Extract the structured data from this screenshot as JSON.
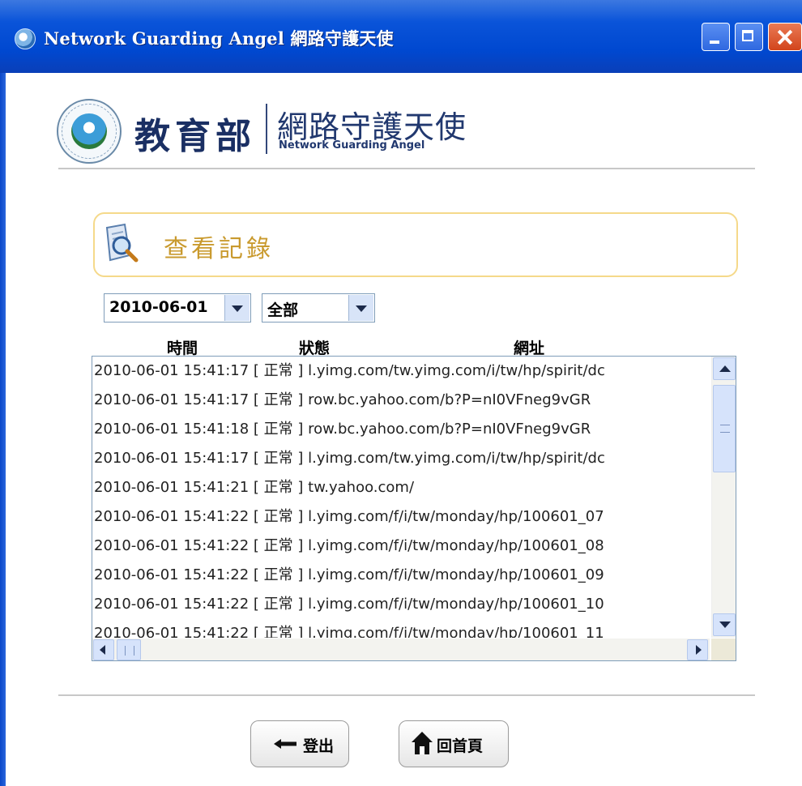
{
  "window": {
    "title": "Network Guarding Angel 網路守護天使"
  },
  "header": {
    "ministry": "教育部",
    "brand_cn": "網路守護天使",
    "brand_en": "Network Guarding Angel"
  },
  "section": {
    "title": "查看記錄"
  },
  "filters": {
    "date": "2010-06-01",
    "status": "全部"
  },
  "columns": [
    "時間",
    "狀態",
    "網址"
  ],
  "rows": [
    {
      "time": "2010-06-01 15:41:17",
      "status": "[ 正常 ]",
      "url": "l.yimg.com/tw.yimg.com/i/tw/hp/spirit/dc"
    },
    {
      "time": "2010-06-01 15:41:17",
      "status": "[ 正常 ]",
      "url": "row.bc.yahoo.com/b?P=nI0VFneg9vGR"
    },
    {
      "time": "2010-06-01 15:41:18",
      "status": "[ 正常 ]",
      "url": "row.bc.yahoo.com/b?P=nI0VFneg9vGR"
    },
    {
      "time": "2010-06-01 15:41:17",
      "status": "[ 正常 ]",
      "url": "l.yimg.com/tw.yimg.com/i/tw/hp/spirit/dc"
    },
    {
      "time": "2010-06-01 15:41:21",
      "status": "[ 正常 ]",
      "url": "tw.yahoo.com/"
    },
    {
      "time": "2010-06-01 15:41:22",
      "status": "[ 正常 ]",
      "url": "l.yimg.com/f/i/tw/monday/hp/100601_07"
    },
    {
      "time": "2010-06-01 15:41:22",
      "status": "[ 正常 ]",
      "url": "l.yimg.com/f/i/tw/monday/hp/100601_08"
    },
    {
      "time": "2010-06-01 15:41:22",
      "status": "[ 正常 ]",
      "url": "l.yimg.com/f/i/tw/monday/hp/100601_09"
    },
    {
      "time": "2010-06-01 15:41:22",
      "status": "[ 正常 ]",
      "url": "l.yimg.com/f/i/tw/monday/hp/100601_10"
    },
    {
      "time": "2010-06-01 15:41:22",
      "status": "[ 正常 ]",
      "url": "l.yimg.com/f/i/tw/monday/hp/100601_11"
    }
  ],
  "buttons": {
    "logout": "登出",
    "home": "回首頁"
  },
  "icons": {
    "app": "angel-globe-icon",
    "section": "magnifier-document-icon",
    "logout": "arrow-left-icon",
    "home": "house-icon"
  },
  "colors": {
    "titlebar": "#0a54d9",
    "section_border": "#f5d98a",
    "section_title": "#c99a2e",
    "brand": "#21386f"
  }
}
